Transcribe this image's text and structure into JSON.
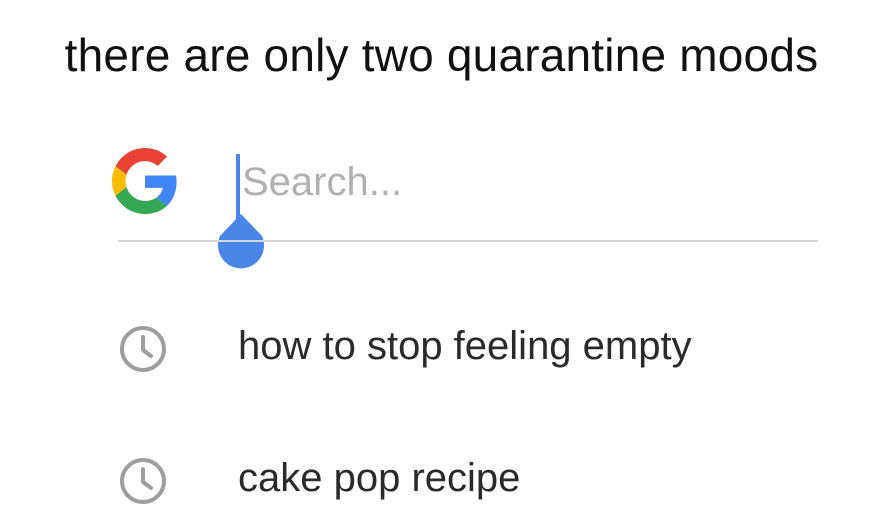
{
  "caption": {
    "text": "there are only two quarantine moods"
  },
  "search": {
    "logo_icon": "google-g-icon",
    "placeholder": "Search...",
    "value": "",
    "caret_color": "#4a86e8",
    "suggestion_icon": "history-clock-icon",
    "suggestions": [
      {
        "label": "how to stop feeling empty"
      },
      {
        "label": "cake pop recipe"
      }
    ]
  },
  "colors": {
    "google_blue": "#4285F4",
    "google_red": "#EA4335",
    "google_yellow": "#FBBC05",
    "google_green": "#34A853",
    "history_icon_gray": "#9e9e9e",
    "divider": "#d5d5d5"
  }
}
